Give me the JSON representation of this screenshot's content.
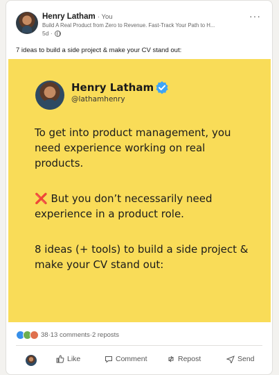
{
  "author": {
    "name": "Henry Latham",
    "relation": "· You",
    "headline": "Build A Real Product from Zero to Revenue. Fast-Track Your Path to H...",
    "time": "5d ·"
  },
  "post": {
    "text": "7 ideas to build a side project & make your CV stand out:"
  },
  "image": {
    "name": "Henry Latham",
    "handle": "@lathamhenry",
    "para1": "To get into product management, you need experience working on real products.",
    "para2_mark": "❌",
    "para2": "But you don’t necessarily need experience in a product role.",
    "para3": "8 ideas (+ tools) to build a side project & make your CV stand out:"
  },
  "social": {
    "reactions": "38",
    "comments": "13 comments",
    "separator": " · ",
    "reposts": "2 reposts"
  },
  "actions": {
    "like": "Like",
    "comment": "Comment",
    "repost": "Repost",
    "send": "Send"
  },
  "colors": {
    "card_bg": "#f9dc58",
    "verified": "#3ea5f5",
    "cross": "#e03a2f"
  }
}
